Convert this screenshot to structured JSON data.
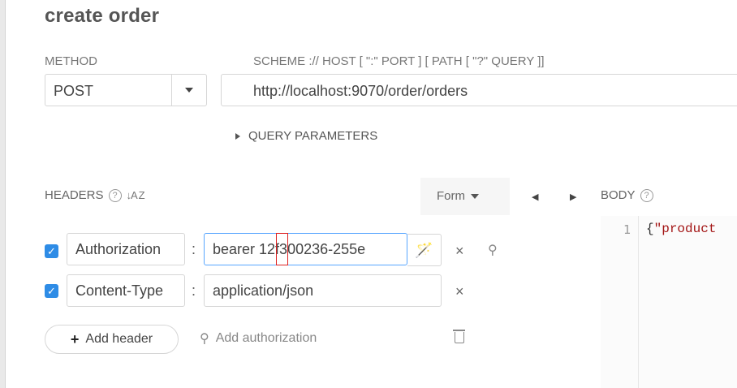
{
  "page": {
    "title": "create order"
  },
  "method": {
    "label": "METHOD",
    "value": "POST"
  },
  "url": {
    "label": "SCHEME :// HOST [ \":\" PORT ] [ PATH [ \"?\" QUERY ]]",
    "value": "http://localhost:9070/order/orders"
  },
  "query_params": {
    "label": "QUERY PARAMETERS"
  },
  "headers": {
    "label": "HEADERS",
    "help": "?",
    "sort": "↓A Z",
    "rows": [
      {
        "name": "Authorization",
        "value": "bearer 12f300236-255e",
        "checked": true
      },
      {
        "name": "Content-Type",
        "value": "application/json",
        "checked": true
      }
    ],
    "add_header_label": "Add header",
    "add_auth_label": "Add authorization"
  },
  "body": {
    "label": "BODY",
    "help": "?",
    "format_label": "Form",
    "line_number": "1",
    "code_brace": "{",
    "code_string": "\"product"
  },
  "icons": {
    "caret": "chevron-down-icon",
    "nav_prev": "◀",
    "nav_next": "▶",
    "check": "✓",
    "close": "×",
    "key": "⚲",
    "wand": "🪄",
    "plus": "+"
  },
  "colors": {
    "checkbox": "#2e8ce6",
    "active_border": "#58a6ff",
    "json_string": "#a31515",
    "highlight": "#dd2222"
  }
}
